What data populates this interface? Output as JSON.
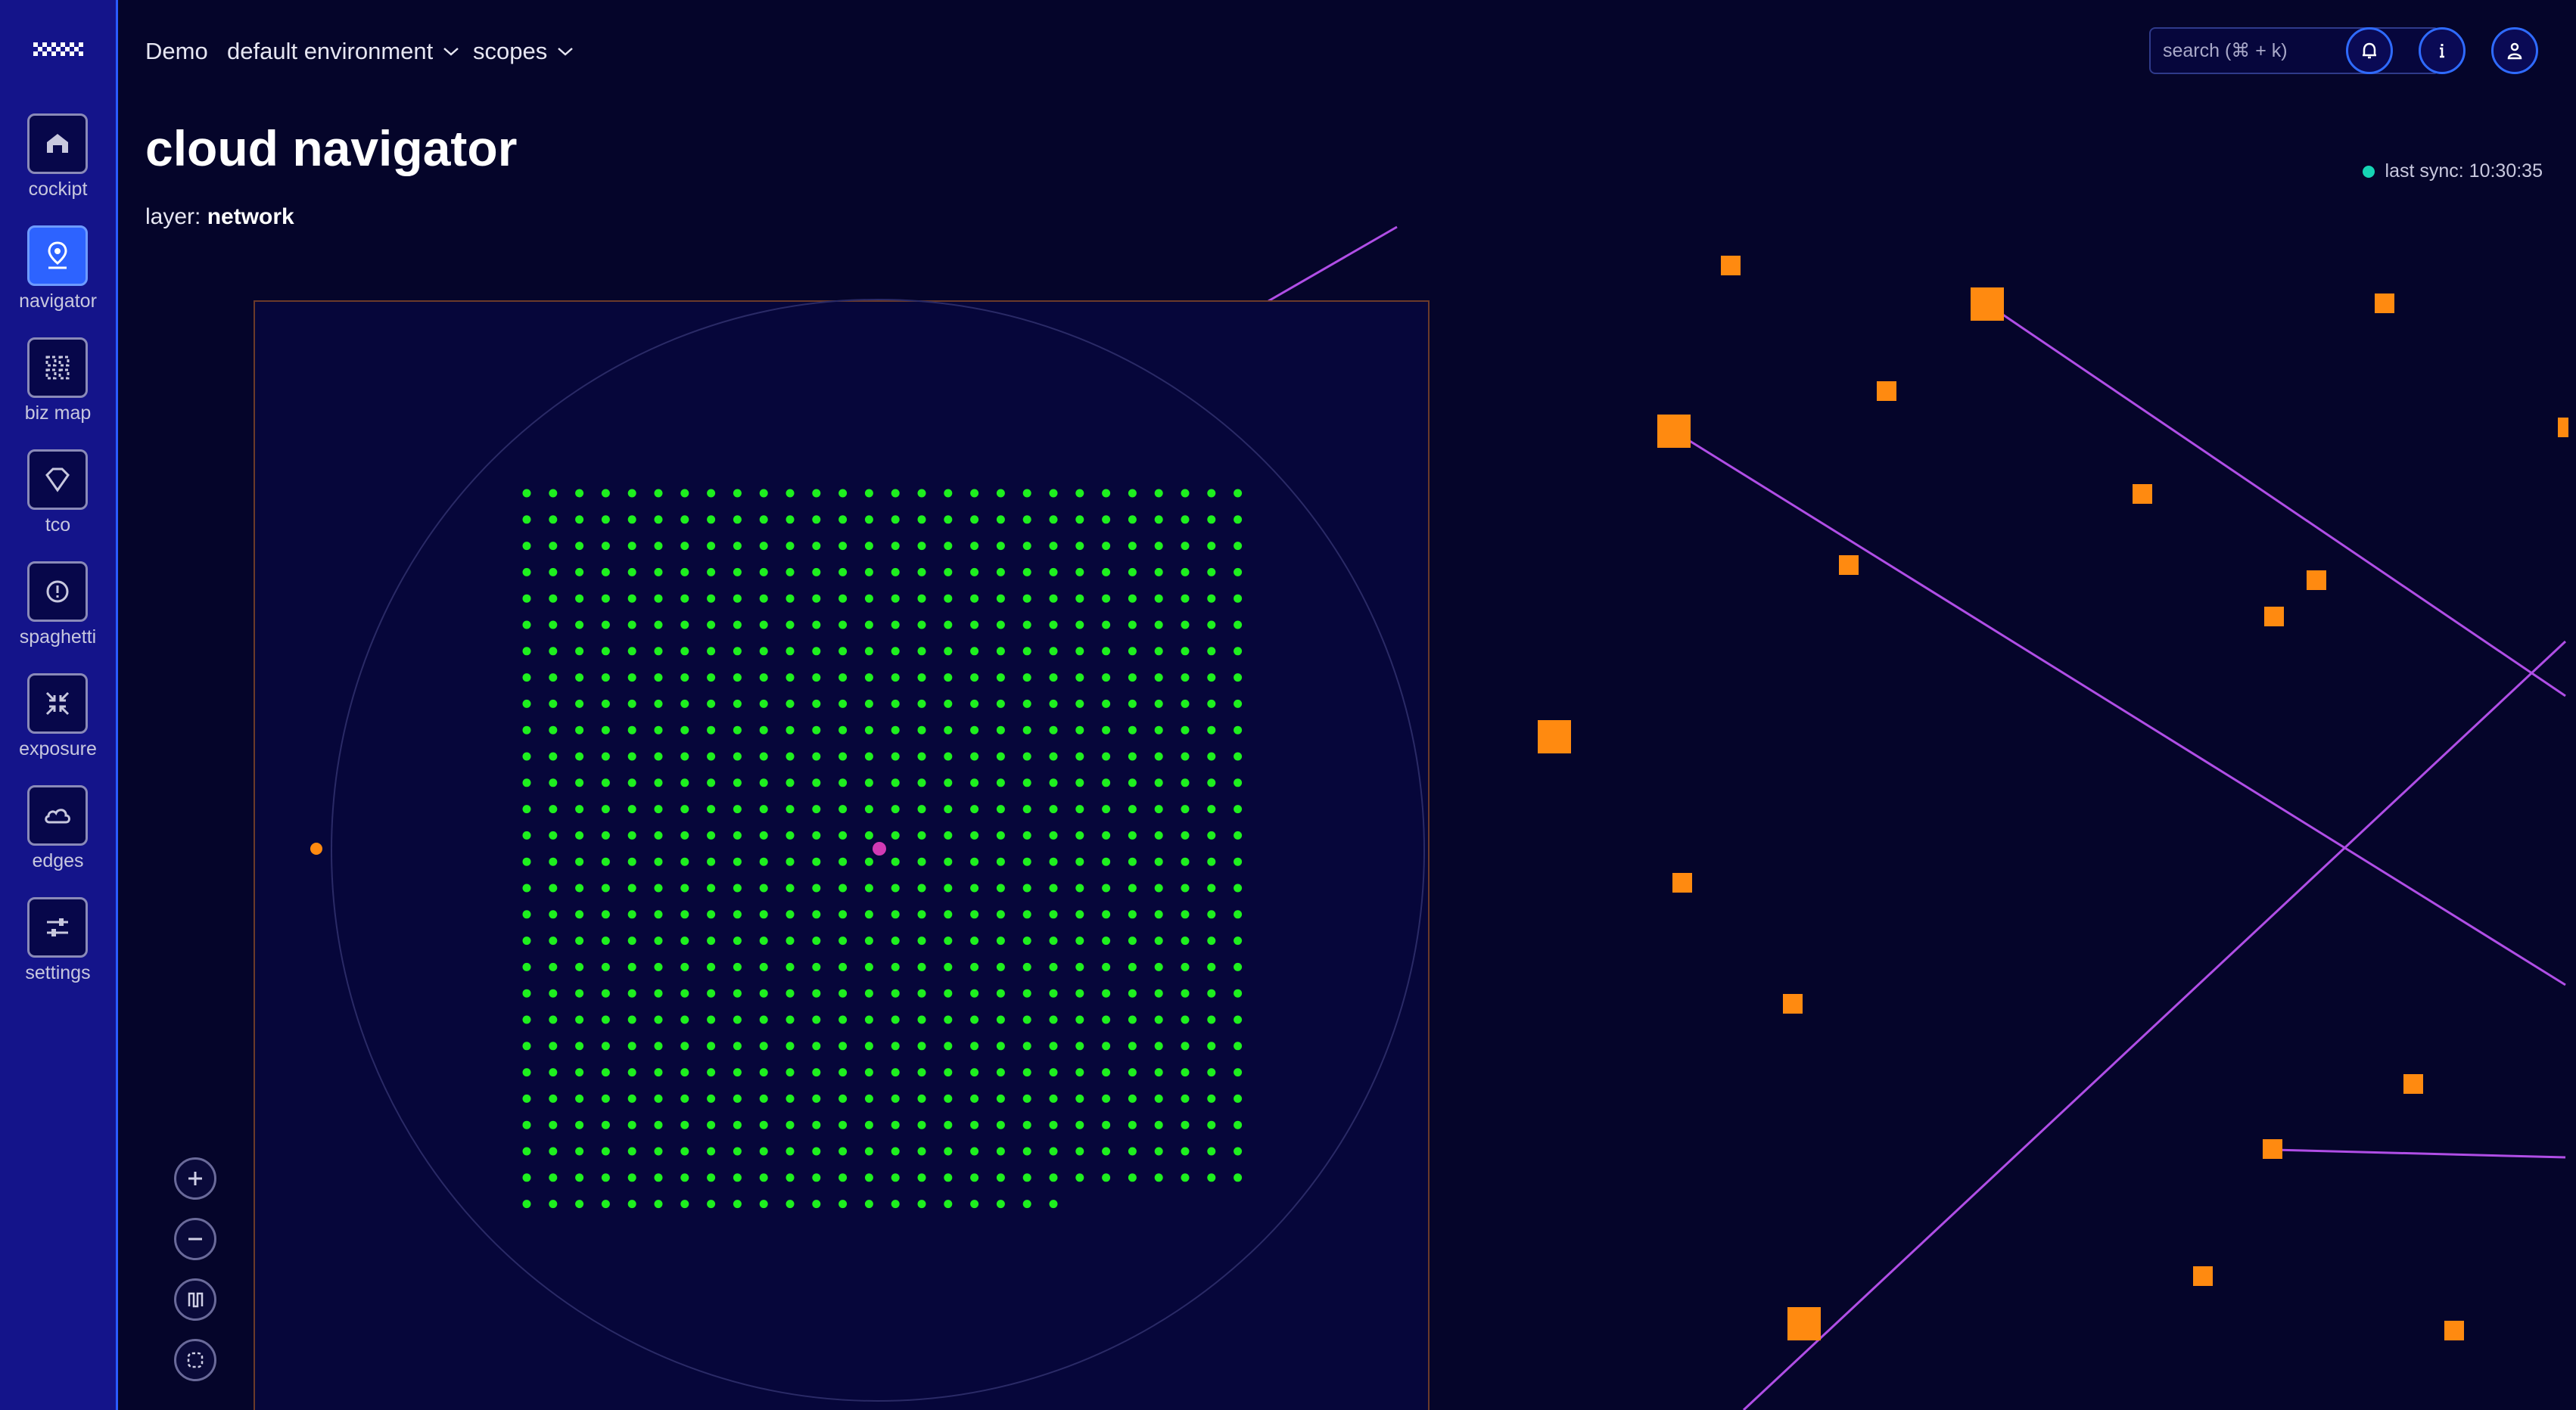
{
  "app": {
    "accent_color": "#2d63ff",
    "background_color": "#05052a",
    "sidebar_color": "#14148a"
  },
  "sidebar": {
    "items": [
      {
        "label": "cockipt",
        "icon": "house-icon",
        "active": false
      },
      {
        "label": "navigator",
        "icon": "map-pin-icon",
        "active": true
      },
      {
        "label": "biz map",
        "icon": "grid-icon",
        "active": false
      },
      {
        "label": "tco",
        "icon": "gem-icon",
        "active": false
      },
      {
        "label": "spaghetti",
        "icon": "alert-circle-icon",
        "active": false
      },
      {
        "label": "exposure",
        "icon": "shrink-icon",
        "active": false
      },
      {
        "label": "edges",
        "icon": "cloud-icon",
        "active": false
      },
      {
        "label": "settings",
        "icon": "sliders-icon",
        "active": false
      }
    ]
  },
  "topbar": {
    "breadcrumb": {
      "org": "Demo",
      "environment": "default environment",
      "scopes": "scopes"
    },
    "search_placeholder": "search (⌘ + k)",
    "buttons": [
      {
        "icon": "bell-icon"
      },
      {
        "icon": "info-icon"
      },
      {
        "icon": "user-icon"
      }
    ]
  },
  "page": {
    "title": "cloud navigator",
    "layer_label": "layer:",
    "layer_value": "network",
    "sync_text": "last sync: 10:30:35",
    "sync_color": "#16d4b4"
  },
  "map": {
    "node_grid": {
      "rows": 28,
      "cols": 28,
      "last_row_count": 21,
      "color": "#1ef01e"
    },
    "center_node_color": "#d23ab4",
    "external_node_color": "#ff8a10",
    "edge_color": "#b04ee6",
    "resource_color": "#ff8a10"
  },
  "zoom_controls": [
    {
      "icon": "zoom-in-icon"
    },
    {
      "icon": "zoom-out-icon"
    },
    {
      "icon": "fit-icon"
    },
    {
      "icon": "select-icon"
    }
  ]
}
